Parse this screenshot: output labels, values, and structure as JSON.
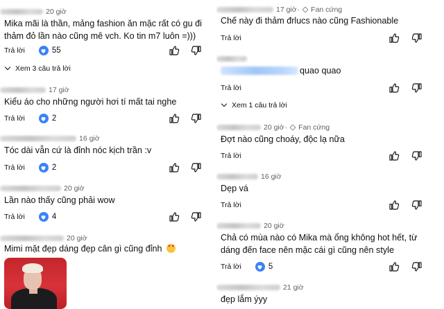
{
  "reply_label": "Trả lời",
  "left_comments": [
    {
      "time": "20 giờ",
      "text": "Mika mãi là thần, mảng fashion ăn mặc rất có gu đi thảm đỏ lần nào cũng mê vch. Ko tin m7 luôn =)))",
      "likes": "55",
      "see_replies": "Xem 3 câu trả lời"
    },
    {
      "time": "17 giờ",
      "text": "Kiểu áo cho những người hơi tí mất tai nghe",
      "likes": "2"
    },
    {
      "time": "16 giờ",
      "text": "Tóc dài vẫn cứ là đỉnh nóc kịch trần :v",
      "likes": "2"
    },
    {
      "time": "20 giờ",
      "text": "Lần nào thấy cũng phải wow",
      "likes": "4"
    },
    {
      "time": "20 giờ",
      "text": "Mimi mặt đẹp dáng đẹp cân gì cũng đỉnh",
      "emoji": "smiling-face-with-heart-eyes"
    }
  ],
  "right_comments": [
    {
      "time": "17 giờ",
      "badge": "Fan cứng",
      "text": "Chế này đi thảm đrlucs nào cũng Fashionable"
    },
    {
      "text": "quao quao",
      "see_replies": "Xem 1 câu trả lời"
    },
    {
      "time": "20 giờ",
      "badge": "Fan cứng",
      "text": "Đợt nào cũng choáy, độc lạ nữa"
    },
    {
      "time": "16 giờ",
      "text": "Dẹp vá"
    },
    {
      "time": "20 giờ",
      "text": "Chả có mùa nào có Mika mà ổng không hot hết, từ dáng đến face nên mặc cái gì cũng nên style",
      "likes": "5"
    },
    {
      "time": "21 giờ",
      "text": "đẹp lắm ýyy"
    }
  ],
  "colors": {
    "like_badge": "#3b82f6",
    "secondary_text": "#606060",
    "photo_bg": "#c4262c"
  }
}
